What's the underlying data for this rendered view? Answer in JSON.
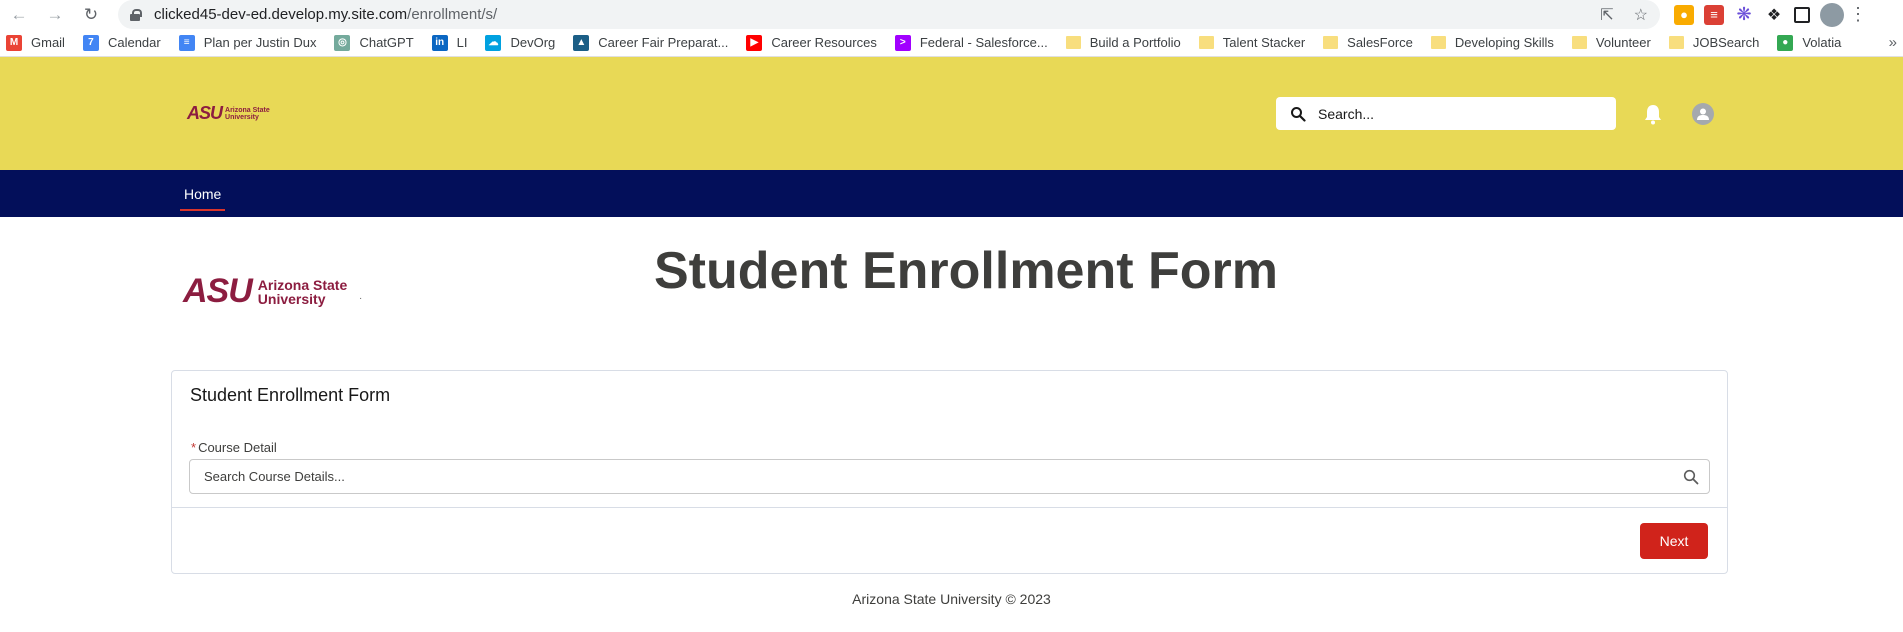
{
  "browser": {
    "url_host": "clicked45-dev-ed.develop.my.site.com",
    "url_path": "/enrollment/s/",
    "bookmarks": [
      {
        "label": "Gmail",
        "icon": "gmail-icon",
        "color": "#ea4335"
      },
      {
        "label": "Calendar",
        "icon": "calendar-icon",
        "color": "#4285f4"
      },
      {
        "label": "Plan per Justin Dux",
        "icon": "docs-icon",
        "color": "#4285f4"
      },
      {
        "label": "ChatGPT",
        "icon": "chatgpt-icon",
        "color": "#74aa9c"
      },
      {
        "label": "LI",
        "icon": "linkedin-icon",
        "color": "#0a66c2"
      },
      {
        "label": "DevOrg",
        "icon": "cloud-icon",
        "color": "#00a1e0"
      },
      {
        "label": "Career Fair Preparat...",
        "icon": "career-icon",
        "color": "#1b5e86"
      },
      {
        "label": "Career Resources",
        "icon": "youtube-icon",
        "color": "#ff0000"
      },
      {
        "label": "Federal - Salesforce...",
        "icon": "accenture-icon",
        "color": "#a100ff"
      },
      {
        "label": "Build a Portfolio",
        "icon": "folder-icon",
        "color": "#f8de7e"
      },
      {
        "label": "Talent Stacker",
        "icon": "folder-icon",
        "color": "#f8de7e"
      },
      {
        "label": "SalesForce",
        "icon": "folder-icon",
        "color": "#f8de7e"
      },
      {
        "label": "Developing Skills",
        "icon": "folder-icon",
        "color": "#f8de7e"
      },
      {
        "label": "Volunteer",
        "icon": "folder-icon",
        "color": "#f8de7e"
      },
      {
        "label": "JOBSearch",
        "icon": "folder-icon",
        "color": "#f8de7e"
      },
      {
        "label": "Volatia",
        "icon": "globe-icon",
        "color": "#34a853"
      }
    ],
    "bookmarks_more": "»"
  },
  "header": {
    "logo_mark": "ASU",
    "logo_line1": "Arizona State",
    "logo_line2": "University",
    "search_placeholder": "Search..."
  },
  "nav": {
    "home_label": "Home"
  },
  "main": {
    "logo_mark": "ASU",
    "logo_line1": "Arizona State",
    "logo_line2": "University",
    "logo_dot": ".",
    "page_title": "Student Enrollment Form",
    "card_title": "Student Enrollment Form",
    "field_required_marker": "*",
    "field_label": "Course Detail",
    "course_placeholder": "Search Course Details...",
    "next_label": "Next"
  },
  "footer": {
    "text": "Arizona State University © 2023"
  },
  "colors": {
    "header_bg": "#e8d956",
    "nav_bg": "#030f5a",
    "asu_maroon": "#8c1d40",
    "button_red": "#d0231b"
  }
}
